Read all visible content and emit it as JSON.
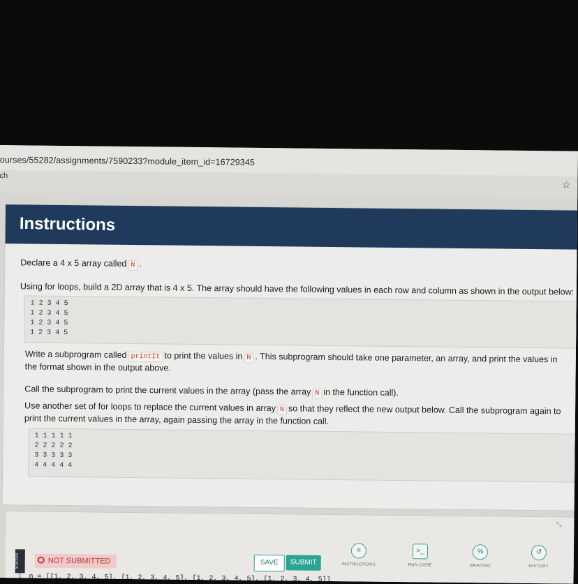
{
  "browser": {
    "url": "ourses/55282/assignments/7590233?module_item_id=16729345",
    "bookmark_text": "ch",
    "star_icon": "☆"
  },
  "instructions": {
    "title": "Instructions",
    "p1_text": "Declare a 4 x 5 array called",
    "p1_code": "N",
    "p1_end": ".",
    "p2": "Using for loops, build a 2D array that is 4 x 5. The array should have the following values in each row and column as shown in the output below:",
    "output1": [
      "1 2 3 4 5",
      "1 2 3 4 5",
      "1 2 3 4 5",
      "1 2 3 4 5"
    ],
    "p3_a": "Write a subprogram called",
    "p3_code1": "printIt",
    "p3_b": "to print the values in",
    "p3_code2": "N",
    "p3_c": ". This subprogram should take one parameter, an array, and print the values in the format shown in the output above.",
    "p4_a": "Call the subprogram to print the current values in the array (pass the array",
    "p4_code": "N",
    "p4_b": "in the function call).",
    "p5_a": "Use another set of for loops to replace the current values in array",
    "p5_code": "N",
    "p5_b": "so that they reflect the new output below. Call the subprogram again to print the current values in the array, again passing the array in the function call.",
    "output2": [
      "1 1 1 1 1",
      "2 2 2 2 2",
      "3 3 3 3 3",
      "4 4 4 4 4"
    ]
  },
  "ide": {
    "status_tab": "STATUS",
    "not_submitted": "NOT SUBMITTED",
    "save_label": "SAVE",
    "submit_label": "SUBMIT",
    "tools": [
      {
        "label": "INSTRUCTIONS",
        "icon": "≡"
      },
      {
        "label": "RUN CODE",
        "icon": ">_"
      },
      {
        "label": "GRADING",
        "icon": "%"
      },
      {
        "label": "HISTORY",
        "icon": "↺"
      }
    ],
    "expand_icon": "⤡",
    "code_line_number": "1",
    "code_line": "n = [[1, 2, 3, 4, 5], [1, 2, 3, 4, 5], [1, 2, 3, 4, 5], [1, 2, 3, 4, 5]]"
  },
  "colors": {
    "header_bg": "#1f3a5b",
    "accent": "#2aa493",
    "error": "#c0392b"
  }
}
